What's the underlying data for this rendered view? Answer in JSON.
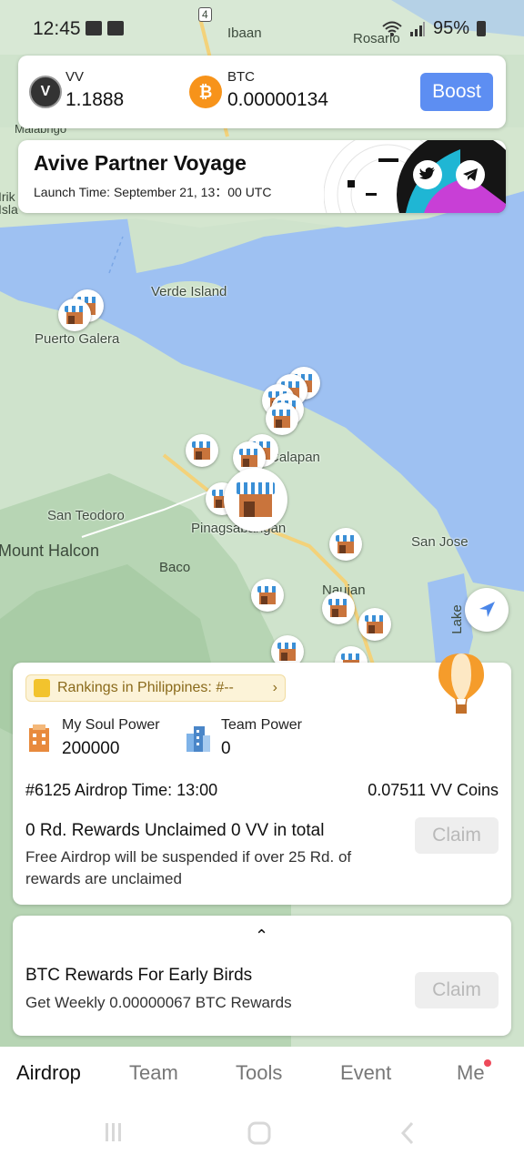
{
  "status_bar": {
    "time": "12:45",
    "battery": "95%"
  },
  "map": {
    "labels": [
      "Ibaan",
      "Rosario",
      "Verde Island",
      "Puerto Galera",
      "San Teodoro",
      "Mount Halcon",
      "Baco",
      "Pinagsabangan",
      "San Jose",
      "Naujan",
      "Calapan",
      "Lake",
      "Malabrigo",
      "Irik",
      "Isla"
    ],
    "road_number": "4"
  },
  "wallet": {
    "vv_label": "VV",
    "vv_value": "1.1888",
    "btc_label": "BTC",
    "btc_value": "0.00000134",
    "boost_label": "Boost"
  },
  "banner": {
    "title": "Avive Partner Voyage",
    "subtitle": "Launch Time: September 21, 13：00 UTC",
    "icons": [
      "twitter-icon",
      "telegram-icon"
    ]
  },
  "airdrop": {
    "ranking_text": "Rankings in Philippines: #--",
    "soul_power_label": "My Soul Power",
    "soul_power_value": "200000",
    "team_power_label": "Team Power",
    "team_power_value": "0",
    "airdrop_time": "#6125 Airdrop Time: 13:00",
    "airdrop_coins": "0.07511 VV Coins",
    "unclaimed": "0 Rd. Rewards Unclaimed 0 VV in total",
    "warning": "Free Airdrop will be suspended if over 25 Rd. of rewards are unclaimed",
    "claim_label": "Claim"
  },
  "btc_rewards": {
    "title": "BTC Rewards For Early Birds",
    "subtitle": "Get Weekly 0.00000067 BTC Rewards",
    "claim_label": "Claim"
  },
  "nav": {
    "tabs": [
      "Airdrop",
      "Team",
      "Tools",
      "Event",
      "Me"
    ],
    "active": "Airdrop"
  },
  "colors": {
    "accent": "#5d8ef2",
    "btc": "#f7931a",
    "water": "#9ec1f2",
    "land": "#cfe3cc"
  }
}
